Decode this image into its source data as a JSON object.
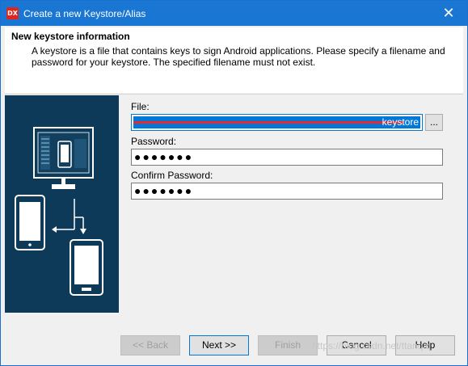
{
  "window": {
    "title": "Create a new Keystore/Alias",
    "app_icon_text": "DX",
    "close_glyph": "✕"
  },
  "header": {
    "title": "New keystore information",
    "description": "A keystore is a file that contains keys to sign Android applications. Please specify a filename and password for your keystore. The specified filename must not exist."
  },
  "form": {
    "file_label": "File:",
    "file_value_tail": "keystore",
    "browse_label": "...",
    "password_label": "Password:",
    "password_value": "●●●●●●●",
    "confirm_label": "Confirm Password:",
    "confirm_value": "●●●●●●●"
  },
  "buttons": {
    "back": "<< Back",
    "next": "Next >>",
    "finish": "Finish",
    "cancel": "Cancel",
    "help": "Help"
  },
  "watermark": "https://blog.csdn.net/ttanqiq",
  "colors": {
    "titlebar": "#1976d2",
    "art_background": "#0c3a58",
    "selection": "#0078d7",
    "redaction": "#e8292f"
  }
}
